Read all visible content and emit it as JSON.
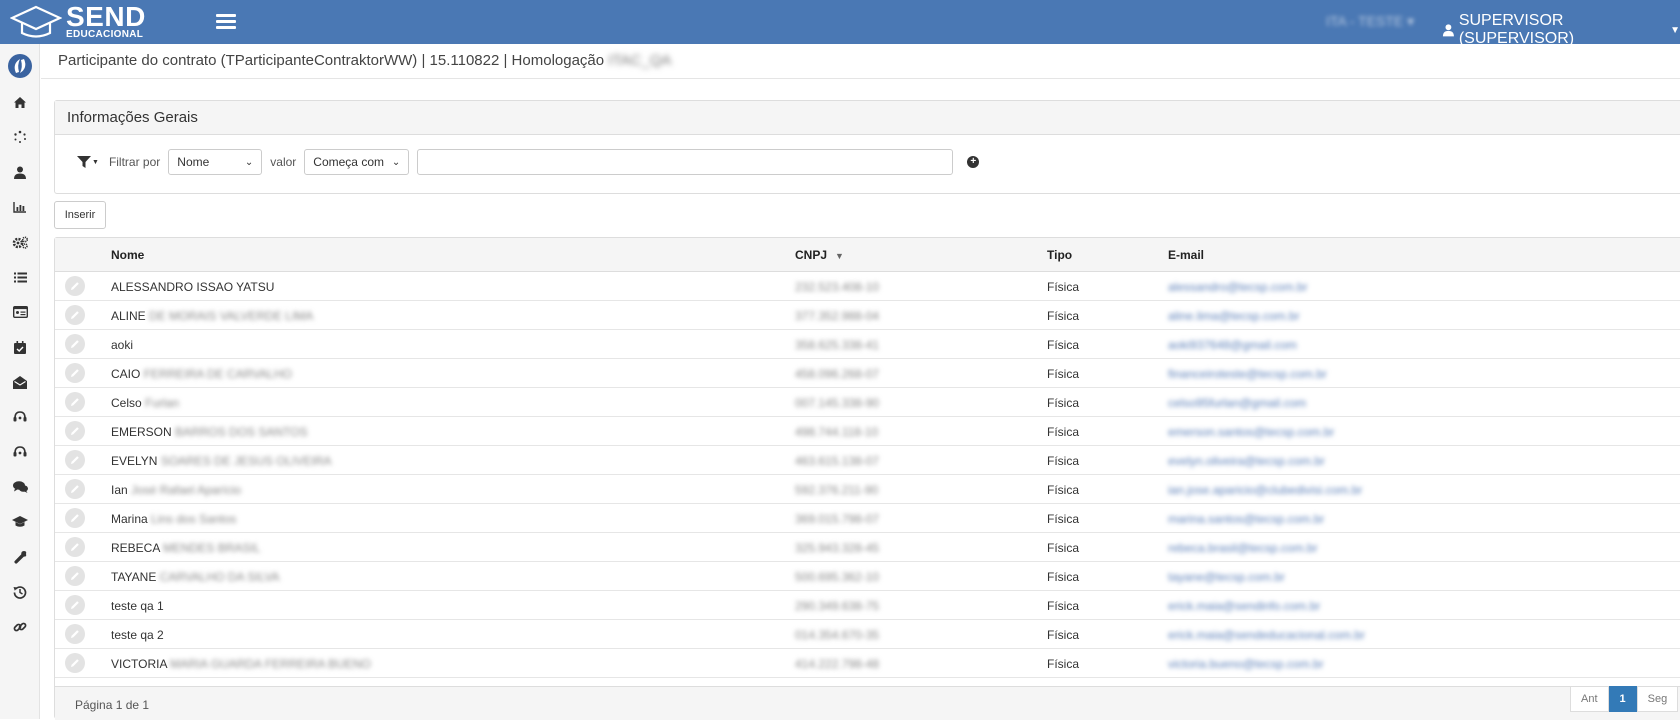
{
  "brand": {
    "name": "SEND",
    "subtitle": "EDUCACIONAL"
  },
  "header": {
    "tenant": "ITA - TESTE",
    "user": "SUPERVISOR (SUPERVISOR)"
  },
  "sidebar": {
    "icons": [
      "home-icon",
      "spinner-icon",
      "user-icon",
      "bar-chart-icon",
      "gears-icon",
      "list-icon",
      "id-card-icon",
      "calendar-check-icon",
      "envelope-open-icon",
      "headset-icon",
      "headset-alt-icon",
      "comments-icon",
      "graduation-cap-icon",
      "wrench-icon",
      "history-icon",
      "link-icon"
    ]
  },
  "breadcrumb": {
    "text": "Participante do contrato (TParticipanteContraktorWW) | 15.110822 | Homologação",
    "env": "ITAC_QA"
  },
  "panel": {
    "title": "Informações Gerais",
    "filter_label": "Filtrar por",
    "field_value": "Nome",
    "value_label": "valor",
    "operator_value": "Começa com",
    "search_value": ""
  },
  "actions": {
    "insert": "Inserir"
  },
  "grid": {
    "columns": [
      "Nome",
      "CNPJ",
      "Tipo",
      "E-mail"
    ],
    "rows": [
      {
        "name": "ALESSANDRO ISSAO YATSU",
        "name_rest": "",
        "cnpj": "232.523.408-10",
        "tipo": "Física",
        "email": "alessandro@tecsp.com.br"
      },
      {
        "name": "ALINE",
        "name_rest": "DE MORAIS VALVERDE LIMA",
        "cnpj": "377.352.988-04",
        "tipo": "Física",
        "email": "aline.lima@tecsp.com.br"
      },
      {
        "name": "aoki",
        "name_rest": "",
        "cnpj": "358.625.338-41",
        "tipo": "Física",
        "email": "aoki937648@gmail.com"
      },
      {
        "name": "CAIO",
        "name_rest": "FERREIRA DE CARVALHO",
        "cnpj": "458.096.268-07",
        "tipo": "Física",
        "email": "financeiroteste@tecsp.com.br"
      },
      {
        "name": "Celso",
        "name_rest": "Furlan",
        "cnpj": "007.145.338-90",
        "tipo": "Física",
        "email": "celso95furlan@gmail.com"
      },
      {
        "name": "EMERSON",
        "name_rest": "BARROS DOS SANTOS",
        "cnpj": "498.744.118-10",
        "tipo": "Física",
        "email": "emerson.santos@tecsp.com.br"
      },
      {
        "name": "EVELYN",
        "name_rest": "SOARES DE JESUS OLIVEIRA",
        "cnpj": "463.615.138-07",
        "tipo": "Física",
        "email": "evelyn.oliveira@tecsp.com.br"
      },
      {
        "name": "Ian",
        "name_rest": "José Rafael Aparício",
        "cnpj": "592.376.211-90",
        "tipo": "Física",
        "email": "ian.jose.aparicio@clubedivisi.com.br"
      },
      {
        "name": "Marina",
        "name_rest": "Lins dos Santos",
        "cnpj": "369.015.798-07",
        "tipo": "Física",
        "email": "marina.santos@tecsp.com.br"
      },
      {
        "name": "REBECA",
        "name_rest": "MENDES BRASIL",
        "cnpj": "325.943.328-45",
        "tipo": "Física",
        "email": "rebeca.brasil@tecsp.com.br"
      },
      {
        "name": "TAYANE",
        "name_rest": "CARVALHO DA SILVA",
        "cnpj": "500.695.362-10",
        "tipo": "Física",
        "email": "tayane@tecsp.com.br"
      },
      {
        "name": "teste qa 1",
        "name_rest": "",
        "cnpj": "290.349.638-75",
        "tipo": "Física",
        "email": "erick.maia@sendinfo.com.br"
      },
      {
        "name": "teste qa 2",
        "name_rest": "",
        "cnpj": "014.354.670-35",
        "tipo": "Física",
        "email": "erick.maia@sendeducacional.com.br"
      },
      {
        "name": "VICTORIA",
        "name_rest": "MARIA GUARDA FERREIRA BUENO",
        "cnpj": "414.222.798-48",
        "tipo": "Física",
        "email": "victoria.bueno@tecsp.com.br"
      }
    ],
    "footer": {
      "page_info": "Página 1 de 1",
      "prev": "Ant",
      "current": "1",
      "next": "Seg"
    }
  },
  "colors": {
    "topbar": "#4a78b4",
    "accent": "#337ab7"
  }
}
